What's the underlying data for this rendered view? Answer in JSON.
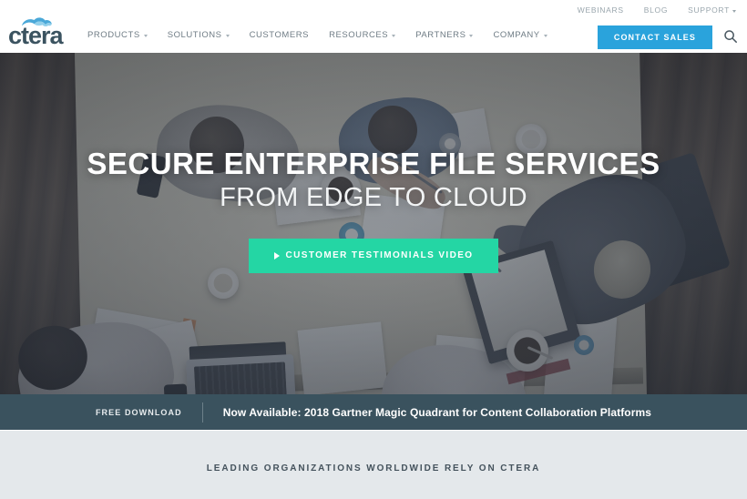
{
  "header": {
    "logo_text": "ctera",
    "logo_icon": "cloud-icon",
    "utility_nav": [
      {
        "label": "WEBINARS",
        "has_caret": false
      },
      {
        "label": "BLOG",
        "has_caret": false
      },
      {
        "label": "SUPPORT",
        "has_caret": true
      }
    ],
    "main_nav": [
      {
        "label": "PRODUCTS",
        "has_caret": true
      },
      {
        "label": "SOLUTIONS",
        "has_caret": true
      },
      {
        "label": "CUSTOMERS",
        "has_caret": false
      },
      {
        "label": "RESOURCES",
        "has_caret": true
      },
      {
        "label": "PARTNERS",
        "has_caret": true
      },
      {
        "label": "COMPANY",
        "has_caret": true
      }
    ],
    "contact_sales_label": "CONTACT SALES",
    "search_icon": "search-icon",
    "contact_sales_color": "#2aa3dc"
  },
  "hero": {
    "title": "SECURE ENTERPRISE FILE SERVICES",
    "subtitle": "FROM EDGE TO CLOUD",
    "cta_label": "CUSTOMER TESTIMONIALS VIDEO",
    "cta_icon": "play-icon",
    "cta_color": "#24d6a4"
  },
  "banner": {
    "free_download_label": "FREE DOWNLOAD",
    "text": "Now Available: 2018 Gartner Magic Quadrant for Content Collaboration Platforms",
    "background_color": "#3a525e"
  },
  "logos_section": {
    "heading": "LEADING ORGANIZATIONS WORLDWIDE RELY ON CTERA",
    "background_color": "#e4e8eb"
  }
}
